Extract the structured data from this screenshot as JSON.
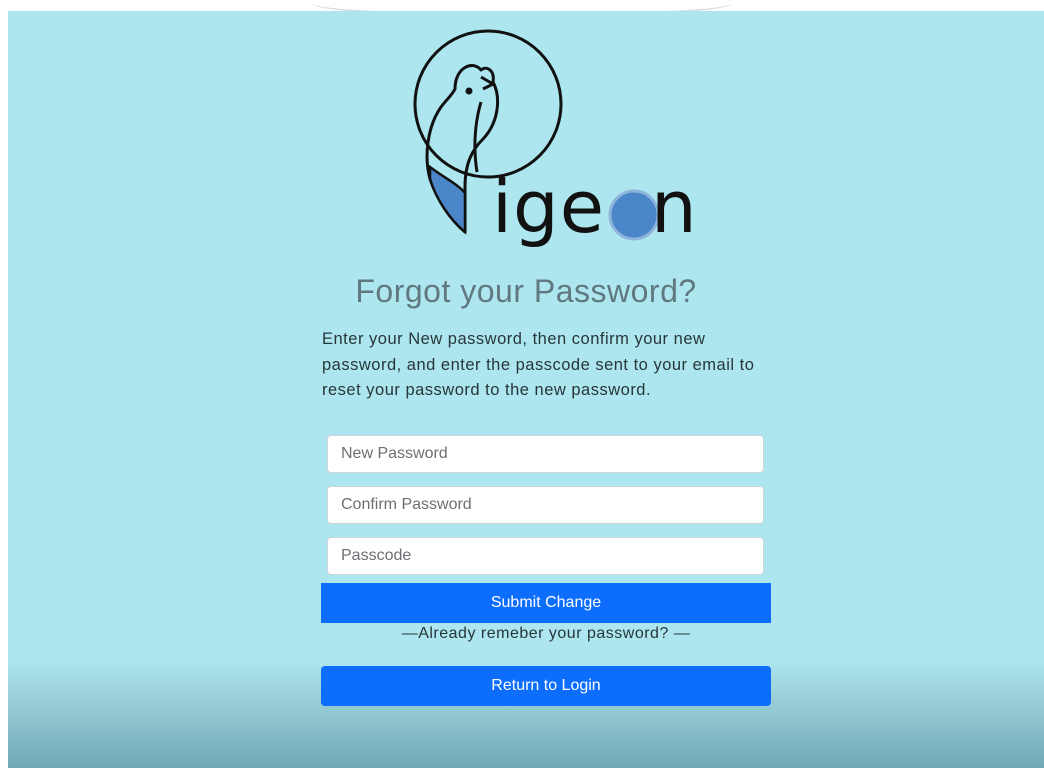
{
  "logo": {
    "text": "Pigeon",
    "word_rest": "ige",
    "word_end": "n",
    "colors": {
      "blue": "#4a86c8",
      "ink": "#111111"
    }
  },
  "form": {
    "title": "Forgot your Password?",
    "description": "Enter your New password, then confirm your new password, and enter the passcode sent to your email to reset your password to the new password.",
    "new_password": {
      "placeholder": "New Password",
      "value": ""
    },
    "confirm_password": {
      "placeholder": "Confirm Password",
      "value": ""
    },
    "passcode": {
      "placeholder": "Passcode",
      "value": ""
    },
    "submit_label": "Submit Change",
    "divider_text": "—Already remeber your password? —",
    "return_label": "Return to Login"
  },
  "colors": {
    "background": "#ade6ee",
    "accent": "#0d6efd",
    "title": "#607880"
  }
}
